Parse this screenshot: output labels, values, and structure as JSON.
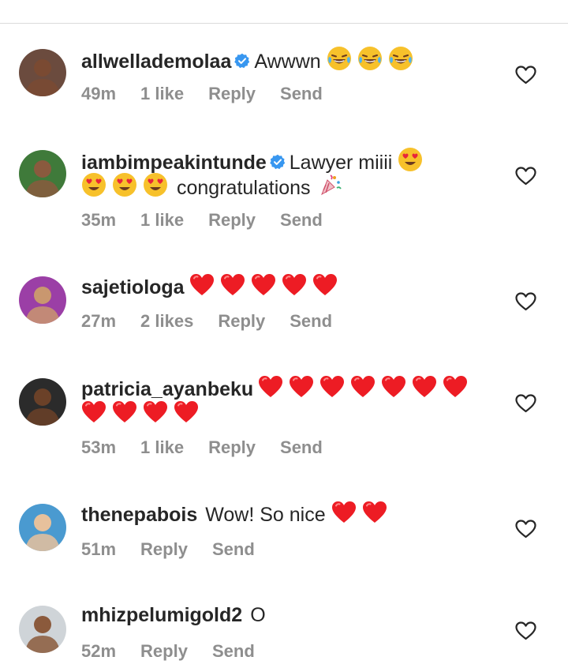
{
  "comments": [
    {
      "username": "allwellademolaa",
      "verified": true,
      "text_before": "Awwwn",
      "emojis_inline": [
        "laughing-tears",
        "laughing-tears",
        "laughing-tears"
      ],
      "line2": null,
      "time": "49m",
      "likes": "1 like",
      "reply": "Reply",
      "send": "Send",
      "avatar_color": "#6b4b3e"
    },
    {
      "username": "iambimpeakintunde",
      "verified": true,
      "text_before": "Lawyer miiii",
      "emojis_inline": [
        "heart-eyes"
      ],
      "line2": {
        "emojis": [
          "heart-eyes",
          "heart-eyes",
          "heart-eyes"
        ],
        "text": "congratulations"
      },
      "time": "35m",
      "likes": "1 like",
      "reply": "Reply",
      "send": "Send",
      "avatar_color": "#3f7a3a"
    },
    {
      "username": "sajetiologa",
      "verified": false,
      "text_before": "",
      "emojis_inline": [
        "red-heart",
        "red-heart",
        "red-heart",
        "red-heart",
        "red-heart"
      ],
      "line2": null,
      "time": "27m",
      "likes": "2 likes",
      "reply": "Reply",
      "send": "Send",
      "avatar_color": "#9b3fa6"
    },
    {
      "username": "patricia_ayanbeku",
      "verified": false,
      "text_before": "",
      "emojis_inline": [
        "red-heart",
        "red-heart",
        "red-heart",
        "red-heart",
        "red-heart",
        "red-heart",
        "red-heart"
      ],
      "line2": {
        "emojis": [
          "red-heart",
          "red-heart",
          "red-heart",
          "red-heart"
        ],
        "text": ""
      },
      "time": "53m",
      "likes": "1 like",
      "reply": "Reply",
      "send": "Send",
      "avatar_color": "#2b2b2b"
    },
    {
      "username": "thenepabois",
      "verified": false,
      "text_before": "Wow! So nice",
      "emojis_inline": [
        "red-heart",
        "red-heart"
      ],
      "line2": null,
      "time": "51m",
      "likes": "",
      "reply": "Reply",
      "send": "Send",
      "avatar_color": "#4a9ad0"
    },
    {
      "username": "mhizpelumigold2",
      "verified": false,
      "text_before": "O",
      "emojis_inline": [],
      "line2": null,
      "time": "52m",
      "likes": "",
      "reply": "Reply",
      "send": "Send",
      "avatar_color": "#cfd4d8"
    }
  ],
  "colors": {
    "meta": "#8e8e8e",
    "text": "#262626",
    "verified": "#3897f0",
    "heart": "#ed1c24"
  },
  "icons": {
    "like": "heart-outline-icon",
    "verified": "verified-badge-icon"
  }
}
